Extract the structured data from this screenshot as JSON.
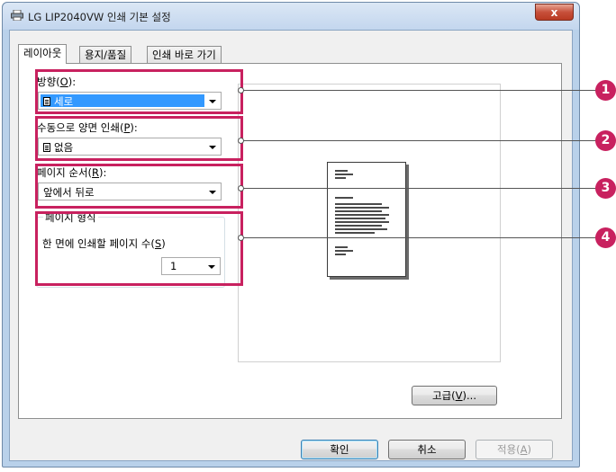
{
  "window": {
    "title": "LG LIP2040VW 인쇄 기본 설정",
    "close_label": "x"
  },
  "tabs": [
    {
      "label": "레이아웃",
      "active": true
    },
    {
      "label": "용지/품질",
      "active": false
    },
    {
      "label": "인쇄 바로 가기",
      "active": false
    }
  ],
  "orientation": {
    "label": "방향(",
    "accel": "O",
    "label_end": "):",
    "value": "세로"
  },
  "duplex": {
    "label": "수동으로 양면 인쇄(",
    "accel": "P",
    "label_end": "):",
    "value": "없음"
  },
  "page_order": {
    "label": "페이지 순서(",
    "accel": "R",
    "label_end": "):",
    "value": "앞에서 뒤로"
  },
  "page_format": {
    "legend": "페이지 형식",
    "pages_per_sheet_label": "한 면에 인쇄할 페이지 수(",
    "accel": "S",
    "label_end": ")",
    "pages_per_sheet_value": "1"
  },
  "buttons": {
    "advanced": "고급(",
    "advanced_accel": "V",
    "advanced_end": ")...",
    "ok": "확인",
    "cancel": "취소",
    "apply": "적용(",
    "apply_accel": "A",
    "apply_end": ")"
  },
  "callouts": [
    "1",
    "2",
    "3",
    "4"
  ],
  "colors": {
    "highlight": "#c8215f",
    "selection": "#3399ff"
  }
}
